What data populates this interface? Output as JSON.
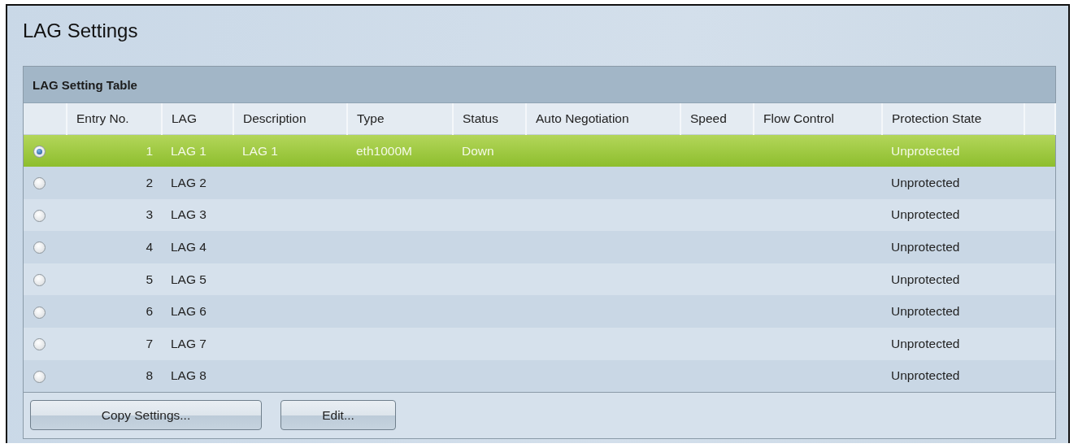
{
  "title": "LAG Settings",
  "table": {
    "caption": "LAG Setting Table",
    "columns": [
      "Entry No.",
      "LAG",
      "Description",
      "Type",
      "Status",
      "Auto Negotiation",
      "Speed",
      "Flow Control",
      "Protection State"
    ],
    "rows": [
      {
        "selected": true,
        "cells": [
          "1",
          "LAG 1",
          "LAG 1",
          "eth1000M",
          "Down",
          null,
          null,
          null,
          "Unprotected"
        ]
      },
      {
        "selected": false,
        "cells": [
          "2",
          "LAG 2",
          null,
          null,
          null,
          null,
          null,
          null,
          "Unprotected"
        ]
      },
      {
        "selected": false,
        "cells": [
          "3",
          "LAG 3",
          null,
          null,
          null,
          null,
          null,
          null,
          "Unprotected"
        ]
      },
      {
        "selected": false,
        "cells": [
          "4",
          "LAG 4",
          null,
          null,
          null,
          null,
          null,
          null,
          "Unprotected"
        ]
      },
      {
        "selected": false,
        "cells": [
          "5",
          "LAG 5",
          null,
          null,
          null,
          null,
          null,
          null,
          "Unprotected"
        ]
      },
      {
        "selected": false,
        "cells": [
          "6",
          "LAG 6",
          null,
          null,
          null,
          null,
          null,
          null,
          "Unprotected"
        ]
      },
      {
        "selected": false,
        "cells": [
          "7",
          "LAG 7",
          null,
          null,
          null,
          null,
          null,
          null,
          "Unprotected"
        ]
      },
      {
        "selected": false,
        "cells": [
          "8",
          "LAG 8",
          null,
          null,
          null,
          null,
          null,
          null,
          "Unprotected"
        ]
      }
    ]
  },
  "buttons": [
    "Copy Settings...",
    "Edit..."
  ]
}
